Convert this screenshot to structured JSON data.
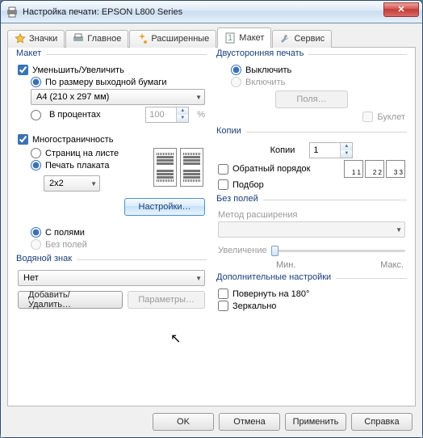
{
  "window": {
    "title": "Настройка печати: EPSON L800 Series"
  },
  "tabs": {
    "icons": {
      "label": "Значки"
    },
    "main": {
      "label": "Главное"
    },
    "adv": {
      "label": "Расширенные"
    },
    "layout": {
      "label": "Макет"
    },
    "service": {
      "label": "Сервис"
    },
    "active": "layout"
  },
  "layout": {
    "legend": "Макет",
    "reduce": {
      "label": "Уменьшить/Увеличить",
      "checked": true
    },
    "fit": {
      "label": "По размеру выходной бумаги"
    },
    "paper": {
      "value": "A4 (210 x 297 мм)"
    },
    "percent": {
      "label": "В процентах",
      "value": "100",
      "suffix": "%"
    },
    "multi": {
      "label": "Многостраничность",
      "checked": true
    },
    "pages_per_sheet": {
      "label": "Страниц на листе"
    },
    "poster": {
      "label": "Печать плаката"
    },
    "poster_size": {
      "value": "2x2"
    },
    "settings_btn": "Настройки…",
    "with_margins": {
      "label": "С полями"
    },
    "borderless": {
      "label": "Без полей"
    }
  },
  "watermark": {
    "legend": "Водяной знак",
    "value": "Нет",
    "add_remove": "Добавить/Удалить…",
    "params": "Параметры…"
  },
  "duplex": {
    "legend": "Двусторонняя печать",
    "off": {
      "label": "Выключить"
    },
    "on": {
      "label": "Включить"
    },
    "margins_btn": "Поля…",
    "booklet": {
      "label": "Буклет"
    }
  },
  "copies": {
    "legend": "Копии",
    "label": "Копии",
    "value": "1",
    "reverse": {
      "label": "Обратный порядок"
    },
    "collate": {
      "label": "Подбор",
      "seq": [
        "1 1",
        "2 2",
        "3 3"
      ]
    }
  },
  "borderless": {
    "legend": "Без полей",
    "method": {
      "label": "Метод расширения"
    },
    "enlarge": {
      "label": "Увеличение"
    },
    "min": "Мин.",
    "max": "Макс."
  },
  "extra": {
    "legend": "Дополнительные настройки",
    "rotate": {
      "label": "Повернуть на  180°"
    },
    "mirror": {
      "label": "Зеркально"
    }
  },
  "buttons": {
    "ok": "OK",
    "cancel": "Отмена",
    "apply": "Применить",
    "help": "Справка"
  }
}
